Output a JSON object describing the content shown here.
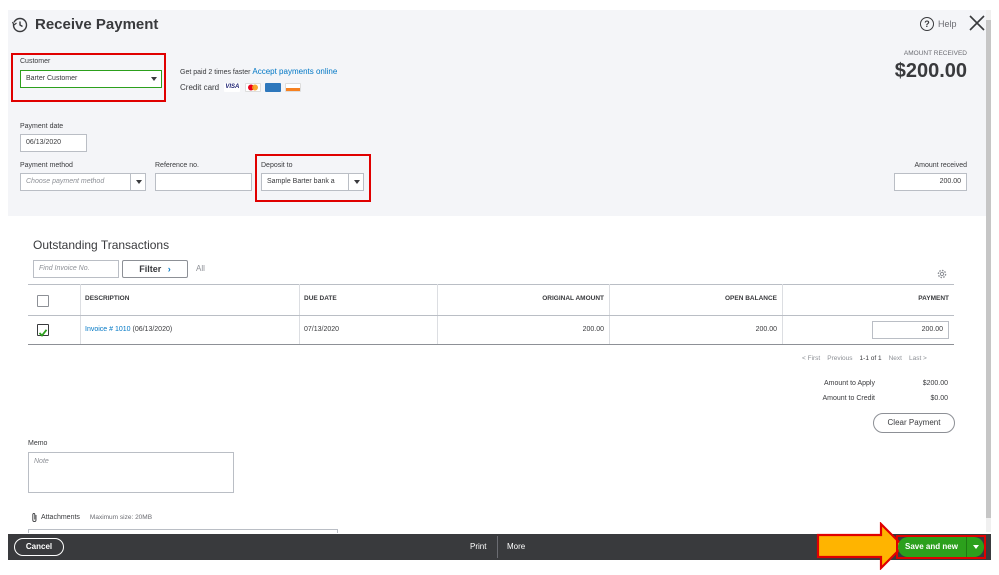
{
  "header": {
    "title": "Receive Payment",
    "help_label": "Help"
  },
  "customer": {
    "label": "Customer",
    "value": "Barter Customer"
  },
  "promo": {
    "text": "Get paid 2 times faster",
    "link": "Accept payments online",
    "credit_card_label": "Credit card",
    "cards": [
      "visa-card-icon",
      "mastercard-card-icon",
      "amex-card-icon",
      "discover-card-icon"
    ]
  },
  "amount_received_header": {
    "label": "AMOUNT RECEIVED",
    "value": "$200.00"
  },
  "payment_date": {
    "label": "Payment date",
    "value": "06/13/2020"
  },
  "payment_method": {
    "label": "Payment method",
    "placeholder": "Choose payment method"
  },
  "reference_no": {
    "label": "Reference no.",
    "value": ""
  },
  "deposit_to": {
    "label": "Deposit to",
    "value": "Sample Barter bank a"
  },
  "amount_received_field": {
    "label": "Amount received",
    "value": "200.00"
  },
  "outstanding": {
    "title": "Outstanding Transactions",
    "find_placeholder": "Find Invoice No.",
    "filter_label": "Filter",
    "all_label": "All",
    "columns": [
      "DESCRIPTION",
      "DUE DATE",
      "ORIGINAL AMOUNT",
      "OPEN BALANCE",
      "PAYMENT"
    ],
    "rows": [
      {
        "checked": true,
        "invoice_link": "Invoice # 1010",
        "invoice_date": " (06/13/2020)",
        "due_date": "07/13/2020",
        "original_amount": "200.00",
        "open_balance": "200.00",
        "payment": "200.00"
      }
    ],
    "pager": {
      "first": "< First",
      "previous": "Previous",
      "range": "1-1 of 1",
      "next": "Next",
      "last": "Last >"
    }
  },
  "summary": {
    "amount_to_apply_label": "Amount to Apply",
    "amount_to_apply_value": "$200.00",
    "amount_to_credit_label": "Amount to Credit",
    "amount_to_credit_value": "$0.00",
    "clear_payment_label": "Clear Payment"
  },
  "memo": {
    "label": "Memo",
    "placeholder": "Note"
  },
  "attachments": {
    "label": "Attachments",
    "max_size": "Maximum size: 20MB"
  },
  "footer": {
    "cancel_label": "Cancel",
    "print_label": "Print",
    "more_label": "More",
    "save_label": "Save and new"
  },
  "colors": {
    "accent_green": "#2ca01c",
    "link_blue": "#0077c5",
    "highlight_red": "#e00000",
    "arrow_orange": "#ffb400",
    "footer_bg": "#393a3d"
  }
}
